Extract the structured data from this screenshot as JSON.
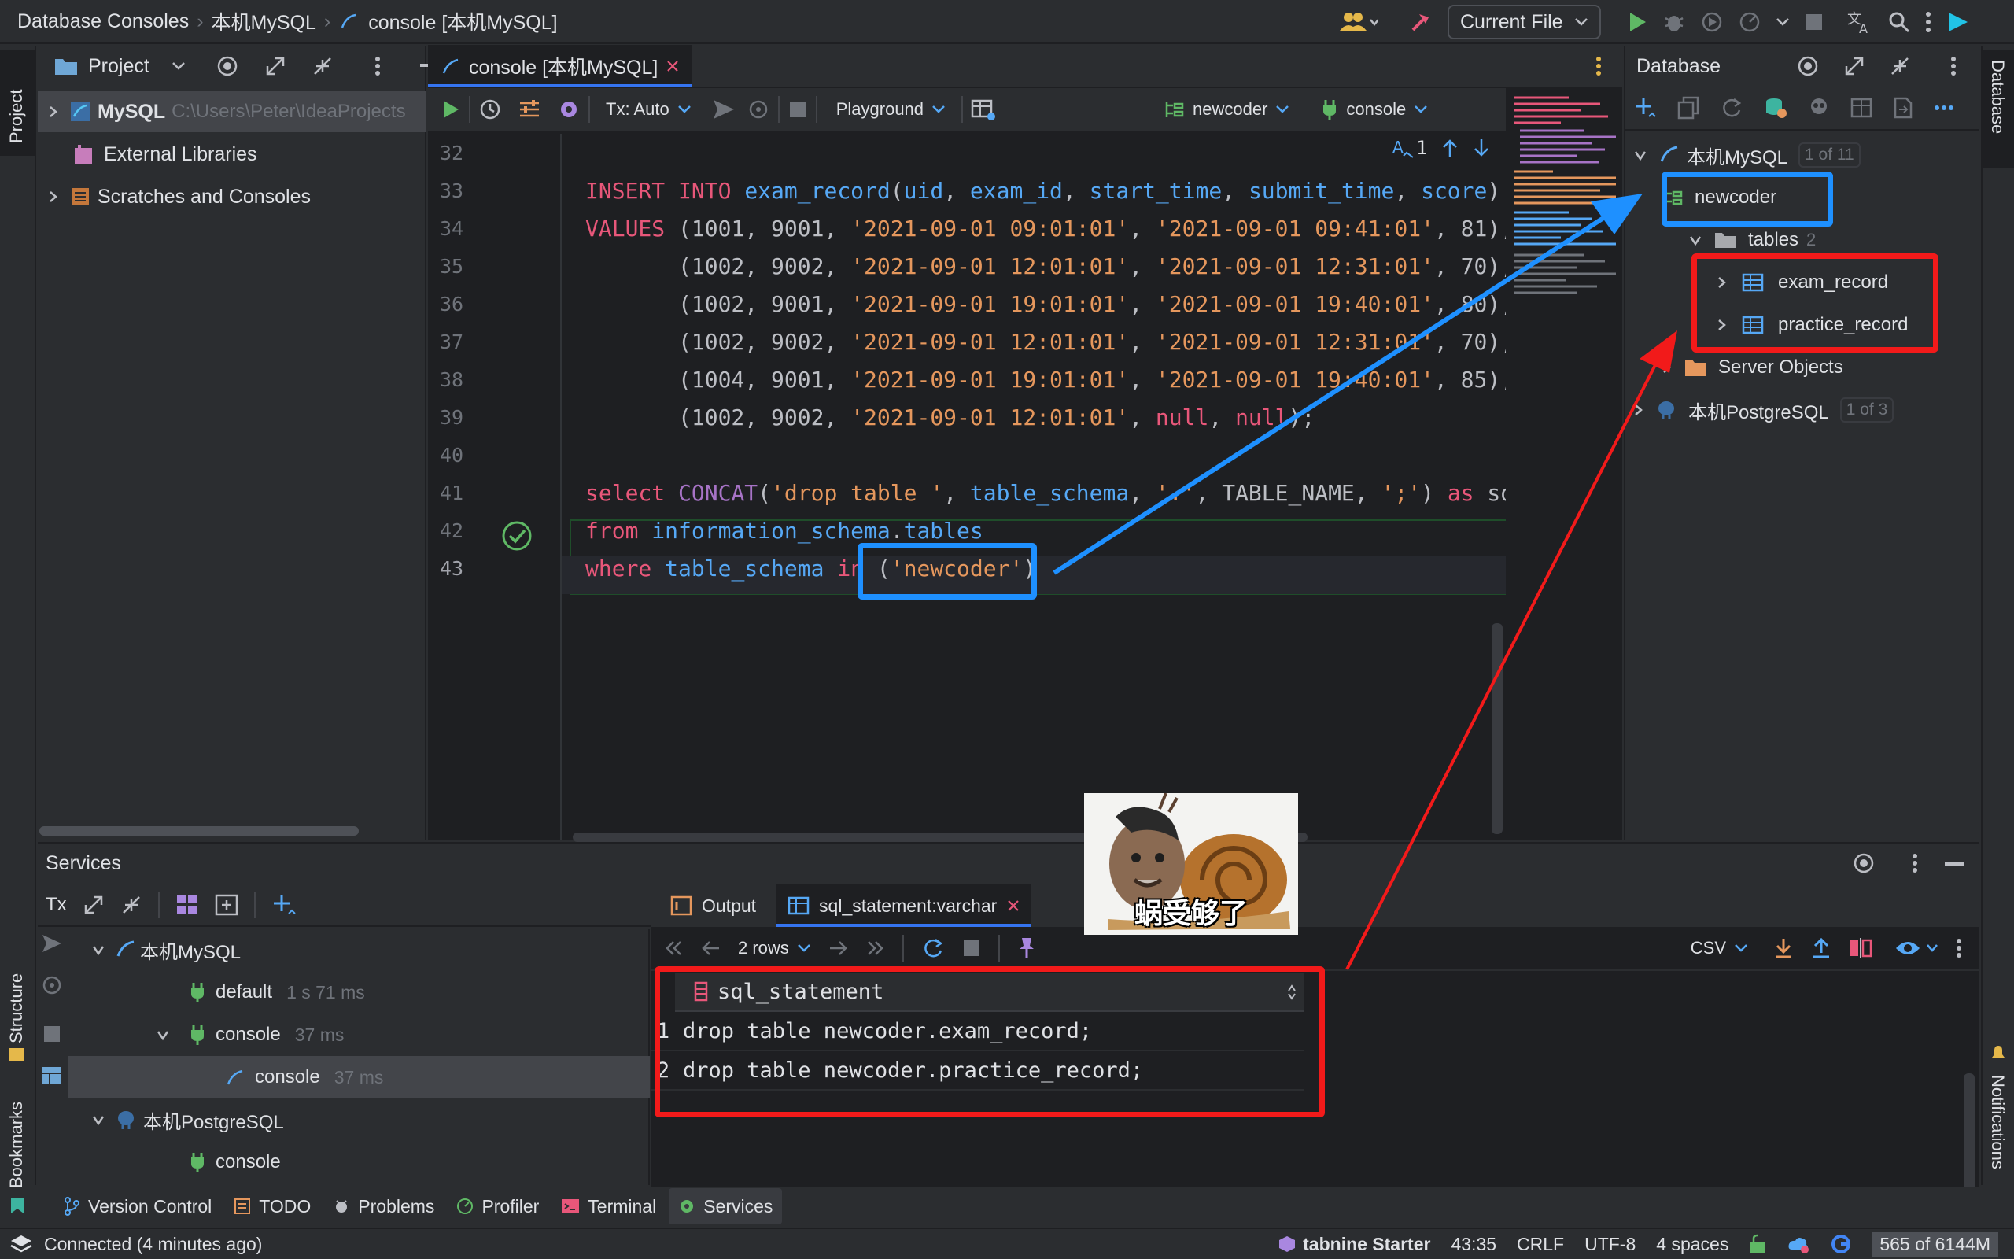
{
  "titlebar": {
    "breadcrumb": [
      "Database Consoles",
      "本机MySQL",
      "console [本机MySQL]"
    ],
    "run_config": "Current File"
  },
  "project": {
    "header": "Project",
    "tree": [
      {
        "label": "MySQL",
        "path": "C:\\Users\\Peter\\IdeaProjects"
      },
      {
        "label": "External Libraries"
      },
      {
        "label": "Scratches and Consoles"
      }
    ]
  },
  "sidestrips": {
    "left": [
      "Project",
      "Structure",
      "Bookmarks"
    ],
    "right": [
      "Database",
      "Notifications"
    ]
  },
  "editor": {
    "tab": "console [本机MySQL]",
    "toolbar": {
      "tx": "Tx: Auto",
      "playground": "Playground",
      "schema": "newcoder",
      "session": "console"
    },
    "hint_count": "1",
    "line_numbers": [
      "32",
      "33",
      "34",
      "35",
      "36",
      "37",
      "38",
      "39",
      "40",
      "41",
      "42",
      "43"
    ],
    "lines": [
      [],
      [
        [
          "kw",
          "INSERT "
        ],
        [
          "kw",
          "INTO "
        ],
        [
          "id",
          "exam_record"
        ],
        [
          "plain",
          "("
        ],
        [
          "id",
          "uid"
        ],
        [
          "plain",
          ", "
        ],
        [
          "id",
          "exam_id"
        ],
        [
          "plain",
          ", "
        ],
        [
          "id",
          "start_time"
        ],
        [
          "plain",
          ", "
        ],
        [
          "id",
          "submit_time"
        ],
        [
          "plain",
          ", "
        ],
        [
          "id",
          "score"
        ],
        [
          "plain",
          ")"
        ]
      ],
      [
        [
          "kw",
          "VALUES "
        ],
        [
          "plain",
          "("
        ],
        [
          "plain",
          "1001"
        ],
        [
          "plain",
          ", "
        ],
        [
          "plain",
          "9001"
        ],
        [
          "plain",
          ", "
        ],
        [
          "str",
          "'2021-09-01 09:01:01'"
        ],
        [
          "plain",
          ", "
        ],
        [
          "str",
          "'2021-09-01 09:41:01'"
        ],
        [
          "plain",
          ", "
        ],
        [
          "plain",
          "81"
        ],
        [
          "plain",
          "),"
        ]
      ],
      [
        [
          "plain",
          "       ("
        ],
        [
          "plain",
          "1002"
        ],
        [
          "plain",
          ", "
        ],
        [
          "plain",
          "9002"
        ],
        [
          "plain",
          ", "
        ],
        [
          "str",
          "'2021-09-01 12:01:01'"
        ],
        [
          "plain",
          ", "
        ],
        [
          "str",
          "'2021-09-01 12:31:01'"
        ],
        [
          "plain",
          ", "
        ],
        [
          "plain",
          "70"
        ],
        [
          "plain",
          "),"
        ]
      ],
      [
        [
          "plain",
          "       ("
        ],
        [
          "plain",
          "1002"
        ],
        [
          "plain",
          ", "
        ],
        [
          "plain",
          "9001"
        ],
        [
          "plain",
          ", "
        ],
        [
          "str",
          "'2021-09-01 19:01:01'"
        ],
        [
          "plain",
          ", "
        ],
        [
          "str",
          "'2021-09-01 19:40:01'"
        ],
        [
          "plain",
          ", "
        ],
        [
          "plain",
          "80"
        ],
        [
          "plain",
          "),"
        ]
      ],
      [
        [
          "plain",
          "       ("
        ],
        [
          "plain",
          "1002"
        ],
        [
          "plain",
          ", "
        ],
        [
          "plain",
          "9002"
        ],
        [
          "plain",
          ", "
        ],
        [
          "str",
          "'2021-09-01 12:01:01'"
        ],
        [
          "plain",
          ", "
        ],
        [
          "str",
          "'2021-09-01 12:31:01'"
        ],
        [
          "plain",
          ", "
        ],
        [
          "plain",
          "70"
        ],
        [
          "plain",
          "),"
        ]
      ],
      [
        [
          "plain",
          "       ("
        ],
        [
          "plain",
          "1004"
        ],
        [
          "plain",
          ", "
        ],
        [
          "plain",
          "9001"
        ],
        [
          "plain",
          ", "
        ],
        [
          "str",
          "'2021-09-01 19:01:01'"
        ],
        [
          "plain",
          ", "
        ],
        [
          "str",
          "'2021-09-01 19:40:01'"
        ],
        [
          "plain",
          ", "
        ],
        [
          "plain",
          "85"
        ],
        [
          "plain",
          "),"
        ]
      ],
      [
        [
          "plain",
          "       ("
        ],
        [
          "plain",
          "1002"
        ],
        [
          "plain",
          ", "
        ],
        [
          "plain",
          "9002"
        ],
        [
          "plain",
          ", "
        ],
        [
          "str",
          "'2021-09-01 12:01:01'"
        ],
        [
          "plain",
          ", "
        ],
        [
          "kw",
          "null"
        ],
        [
          "plain",
          ", "
        ],
        [
          "kw",
          "null"
        ],
        [
          "plain",
          ");"
        ]
      ],
      [],
      [
        [
          "kw",
          "select "
        ],
        [
          "fn",
          "CONCAT"
        ],
        [
          "plain",
          "("
        ],
        [
          "str",
          "'drop table '"
        ],
        [
          "plain",
          ", "
        ],
        [
          "id",
          "table_schema"
        ],
        [
          "plain",
          ", "
        ],
        [
          "str",
          "'.'"
        ],
        [
          "plain",
          ", "
        ],
        [
          "plain",
          "TABLE_NAME"
        ],
        [
          "plain",
          ", "
        ],
        [
          "str",
          "';'"
        ],
        [
          "plain",
          ") "
        ],
        [
          "kw",
          "as "
        ],
        [
          "plain",
          "sql_statement"
        ]
      ],
      [
        [
          "kw",
          "from "
        ],
        [
          "id",
          "information_schema"
        ],
        [
          "plain",
          "."
        ],
        [
          "id",
          "tables"
        ]
      ],
      [
        [
          "kw",
          "where "
        ],
        [
          "id",
          "table_schema "
        ],
        [
          "kw",
          "in "
        ],
        [
          "plain",
          "("
        ],
        [
          "str",
          "'newcoder'"
        ],
        [
          "plain",
          ")"
        ]
      ]
    ]
  },
  "database": {
    "header": "Database",
    "tree": [
      {
        "label": "本机MySQL",
        "badge": "1 of 11"
      },
      {
        "label": "newcoder"
      },
      {
        "label": "tables",
        "count": "2"
      },
      {
        "label": "exam_record"
      },
      {
        "label": "practice_record"
      },
      {
        "label": "Server Objects"
      },
      {
        "label": "本机PostgreSQL",
        "badge": "1 of 3"
      }
    ]
  },
  "services": {
    "header": "Services",
    "tx": "Tx",
    "tree": [
      {
        "label": "本机MySQL"
      },
      {
        "label": "default",
        "time": "1 s 71 ms"
      },
      {
        "label": "console",
        "time": "37 ms"
      },
      {
        "label": "console",
        "time": "37 ms"
      },
      {
        "label": "本机PostgreSQL"
      },
      {
        "label": "console"
      }
    ],
    "tabs": [
      "Output",
      "sql_statement:varchar"
    ],
    "rows_label": "2 rows",
    "format": "CSV",
    "grid": {
      "column": "sql_statement",
      "rows": [
        {
          "n": "1",
          "value": "drop table newcoder.exam_record;"
        },
        {
          "n": "2",
          "value": "drop table newcoder.practice_record;"
        }
      ]
    }
  },
  "meme": {
    "caption": "蜗受够了"
  },
  "bottom_tabs": [
    "Version Control",
    "TODO",
    "Problems",
    "Profiler",
    "Terminal",
    "Services"
  ],
  "statusbar": {
    "left": "Connected (4 minutes ago)",
    "tabnine": "tabnine Starter",
    "pos": "43:35",
    "eol": "CRLF",
    "enc": "UTF-8",
    "indent": "4 spaces",
    "mem": "565 of 6144M"
  },
  "colors": {
    "accent": "#3574f0",
    "annotation_red": "#f21a1a",
    "annotation_blue": "#1e90ff"
  }
}
